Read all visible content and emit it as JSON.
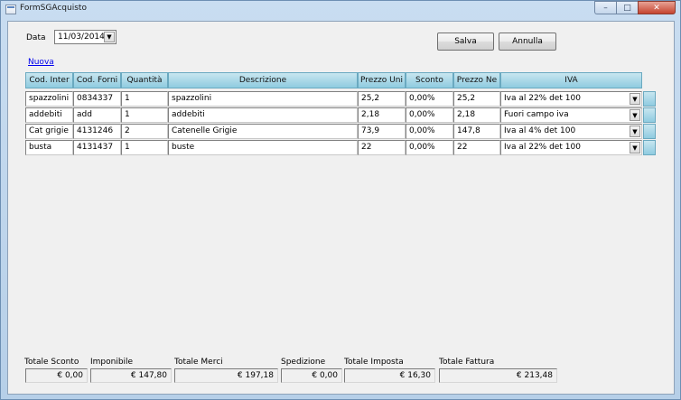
{
  "window": {
    "title": "FormSGAcquisto",
    "minimize": "–",
    "maximize": "□",
    "close": "✕"
  },
  "form": {
    "data_label": "Data",
    "date_value": "11/03/2014",
    "save_label": "Salva",
    "cancel_label": "Annulla",
    "new_link": "Nuova"
  },
  "grid": {
    "headers": [
      "Cod. Inter",
      "Cod. Forni",
      "Quantità",
      "Descrizione",
      "Prezzo Uni",
      "Sconto",
      "Prezzo Ne",
      "IVA"
    ],
    "rows": [
      {
        "cod_inter": "spazzolini",
        "cod_forni": "0834337",
        "quantita": "1",
        "descrizione": "spazzolini",
        "prezzo_uni": "25,2",
        "sconto": "0,00%",
        "prezzo_ne": "25,2",
        "iva": "Iva al 22% det 100"
      },
      {
        "cod_inter": "addebiti",
        "cod_forni": "add",
        "quantita": "1",
        "descrizione": "addebiti",
        "prezzo_uni": "2,18",
        "sconto": "0,00%",
        "prezzo_ne": "2,18",
        "iva": "Fuori campo iva"
      },
      {
        "cod_inter": "Cat grigie",
        "cod_forni": "4131246",
        "quantita": "2",
        "descrizione": "Catenelle Grigie",
        "prezzo_uni": "73,9",
        "sconto": "0,00%",
        "prezzo_ne": "147,8",
        "iva": "Iva al 4% det 100"
      },
      {
        "cod_inter": "busta",
        "cod_forni": "4131437",
        "quantita": "1",
        "descrizione": "buste",
        "prezzo_uni": "22",
        "sconto": "0,00%",
        "prezzo_ne": "22",
        "iva": "Iva al 22% det 100"
      }
    ]
  },
  "totals": {
    "sconto_label": "Totale Sconto",
    "sconto_value": "€ 0,00",
    "imponibile_label": "Imponibile",
    "imponibile_value": "€ 147,80",
    "merci_label": "Totale Merci",
    "merci_value": "€ 197,18",
    "spedizione_label": "Spedizione",
    "spedizione_value": "€ 0,00",
    "imposta_label": "Totale Imposta",
    "imposta_value": "€ 16,30",
    "fattura_label": "Totale Fattura",
    "fattura_value": "€ 213,48"
  },
  "icons": {
    "dropdown": "chevron-down-icon",
    "app": "app-icon"
  }
}
